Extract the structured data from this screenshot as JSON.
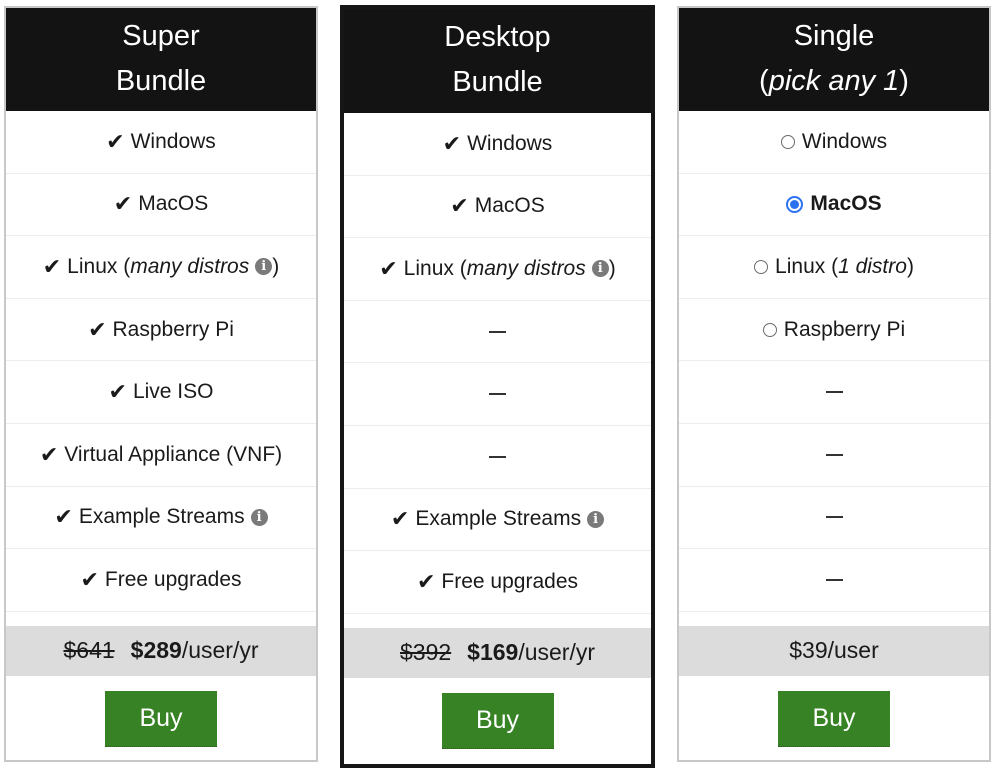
{
  "plans": [
    {
      "title_line1": "Super",
      "title_line2": "Bundle",
      "features": [
        {
          "type": "check",
          "label": "Windows"
        },
        {
          "type": "check",
          "label": "MacOS"
        },
        {
          "type": "check",
          "label": "Linux (",
          "italic": "many distros",
          "info": true,
          "suffix": ")"
        },
        {
          "type": "check",
          "label": "Raspberry Pi"
        },
        {
          "type": "check",
          "label": "Live ISO"
        },
        {
          "type": "check",
          "label": "Virtual Appliance (VNF)"
        },
        {
          "type": "check",
          "label": "Example Streams",
          "info": true
        },
        {
          "type": "check",
          "label": "Free upgrades"
        }
      ],
      "price_old": "$641",
      "price_new": "$289",
      "price_unit": "/user/yr",
      "buy_label": "Buy"
    },
    {
      "title_line1": "Desktop",
      "title_line2": "Bundle",
      "highlighted": true,
      "features": [
        {
          "type": "check",
          "label": "Windows"
        },
        {
          "type": "check",
          "label": "MacOS"
        },
        {
          "type": "check",
          "label": "Linux (",
          "italic": "many distros",
          "info": true,
          "suffix": ")"
        },
        {
          "type": "dash"
        },
        {
          "type": "dash"
        },
        {
          "type": "dash"
        },
        {
          "type": "check",
          "label": "Example Streams",
          "info": true
        },
        {
          "type": "check",
          "label": "Free upgrades"
        }
      ],
      "price_old": "$392",
      "price_new": "$169",
      "price_unit": "/user/yr",
      "buy_label": "Buy"
    },
    {
      "title_line1": "Single",
      "title_line2_prefix": "(",
      "title_line2_italic": "pick any 1",
      "title_line2_suffix": ")",
      "features": [
        {
          "type": "radio",
          "label": "Windows",
          "checked": false
        },
        {
          "type": "radio",
          "label": "MacOS",
          "checked": true
        },
        {
          "type": "radio",
          "label": "Linux (",
          "italic": "1 distro",
          "suffix": ")",
          "checked": false
        },
        {
          "type": "radio",
          "label": "Raspberry Pi",
          "checked": false
        },
        {
          "type": "dash"
        },
        {
          "type": "dash"
        },
        {
          "type": "dash"
        },
        {
          "type": "dash"
        }
      ],
      "price_single": "$39/user",
      "buy_label": "Buy"
    }
  ],
  "icons": {
    "check": "✔",
    "info": "i"
  },
  "colors": {
    "header_bg": "#131313",
    "price_bg": "#dcdcdc",
    "buy_bg": "#368224",
    "radio_accent": "#2b72f0"
  }
}
